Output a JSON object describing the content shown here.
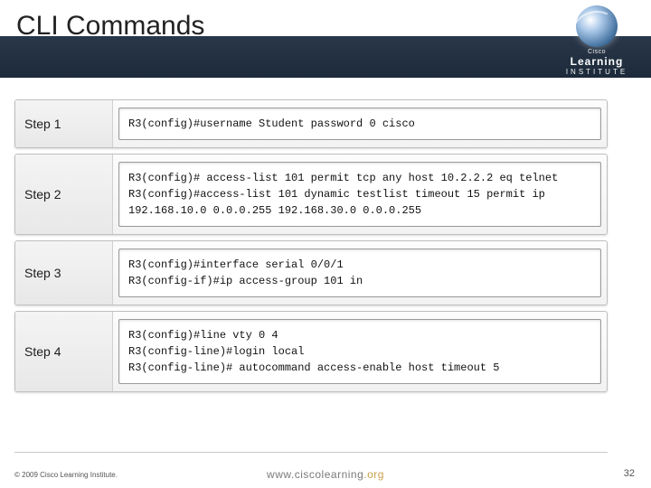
{
  "title": "CLI Commands",
  "brand": {
    "line1": "Cisco",
    "line2": "Learning",
    "line3": "INSTITUTE"
  },
  "steps": [
    {
      "label": "Step 1",
      "command": "R3(config)#username Student password 0 cisco"
    },
    {
      "label": "Step 2",
      "command": "R3(config)# access-list 101 permit tcp any host 10.2.2.2 eq telnet\nR3(config)#access-list 101 dynamic testlist timeout 15 permit ip 192.168.10.0 0.0.0.255 192.168.30.0 0.0.0.255"
    },
    {
      "label": "Step 3",
      "command": "R3(config)#interface serial 0/0/1\nR3(config-if)#ip access-group 101 in"
    },
    {
      "label": "Step 4",
      "command": "R3(config)#line vty 0 4\nR3(config-line)#login local\nR3(config-line)# autocommand access-enable host timeout 5"
    }
  ],
  "footer": {
    "copyright": "© 2009 Cisco Learning Institute.",
    "page": "32",
    "url_prefix": "www.ciscolearning",
    "url_suffix": ".org"
  }
}
